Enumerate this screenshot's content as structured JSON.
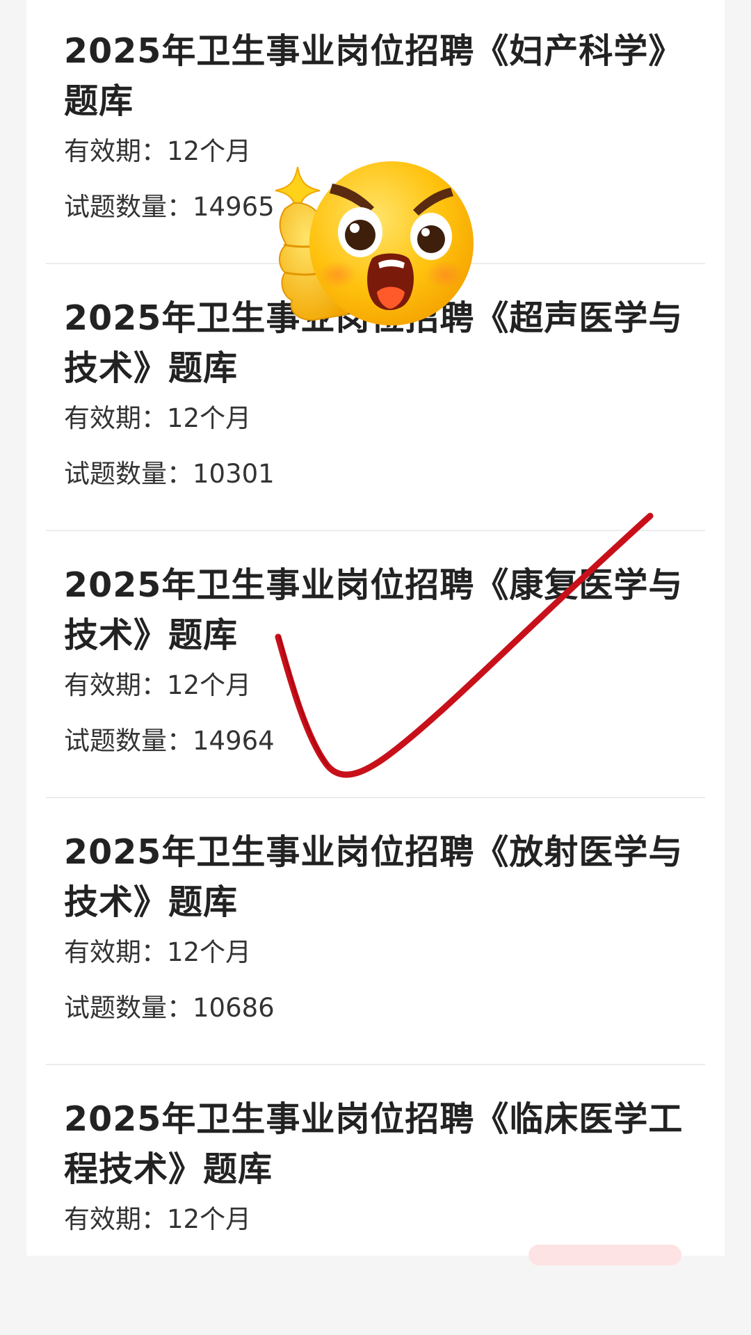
{
  "items": [
    {
      "title": "2025年卫生事业岗位招聘《妇产科学》题库",
      "validity": "有效期：12个月",
      "count": "试题数量：14965"
    },
    {
      "title": "2025年卫生事业岗位招聘《超声医学与技术》题库",
      "validity": "有效期：12个月",
      "count": "试题数量：10301"
    },
    {
      "title": "2025年卫生事业岗位招聘《康复医学与技术》题库",
      "validity": "有效期：12个月",
      "count": "试题数量：14964"
    },
    {
      "title": "2025年卫生事业岗位招聘《放射医学与技术》题库",
      "validity": "有效期：12个月",
      "count": "试题数量：10686"
    },
    {
      "title": "2025年卫生事业岗位招聘《临床医学工程技术》题库",
      "validity": "有效期：12个月",
      "count": ""
    }
  ],
  "stickers": {
    "emoji_icon": "angry-thumbs-up-emoji-icon",
    "sparkle_icon": "sparkle-icon",
    "checkmark_icon": "red-checkmark-icon"
  },
  "colors": {
    "background": "#f5f5f5",
    "card": "#ffffff",
    "text": "#222222",
    "checkmark": "#c8101a",
    "emoji": "#ffc20e"
  }
}
